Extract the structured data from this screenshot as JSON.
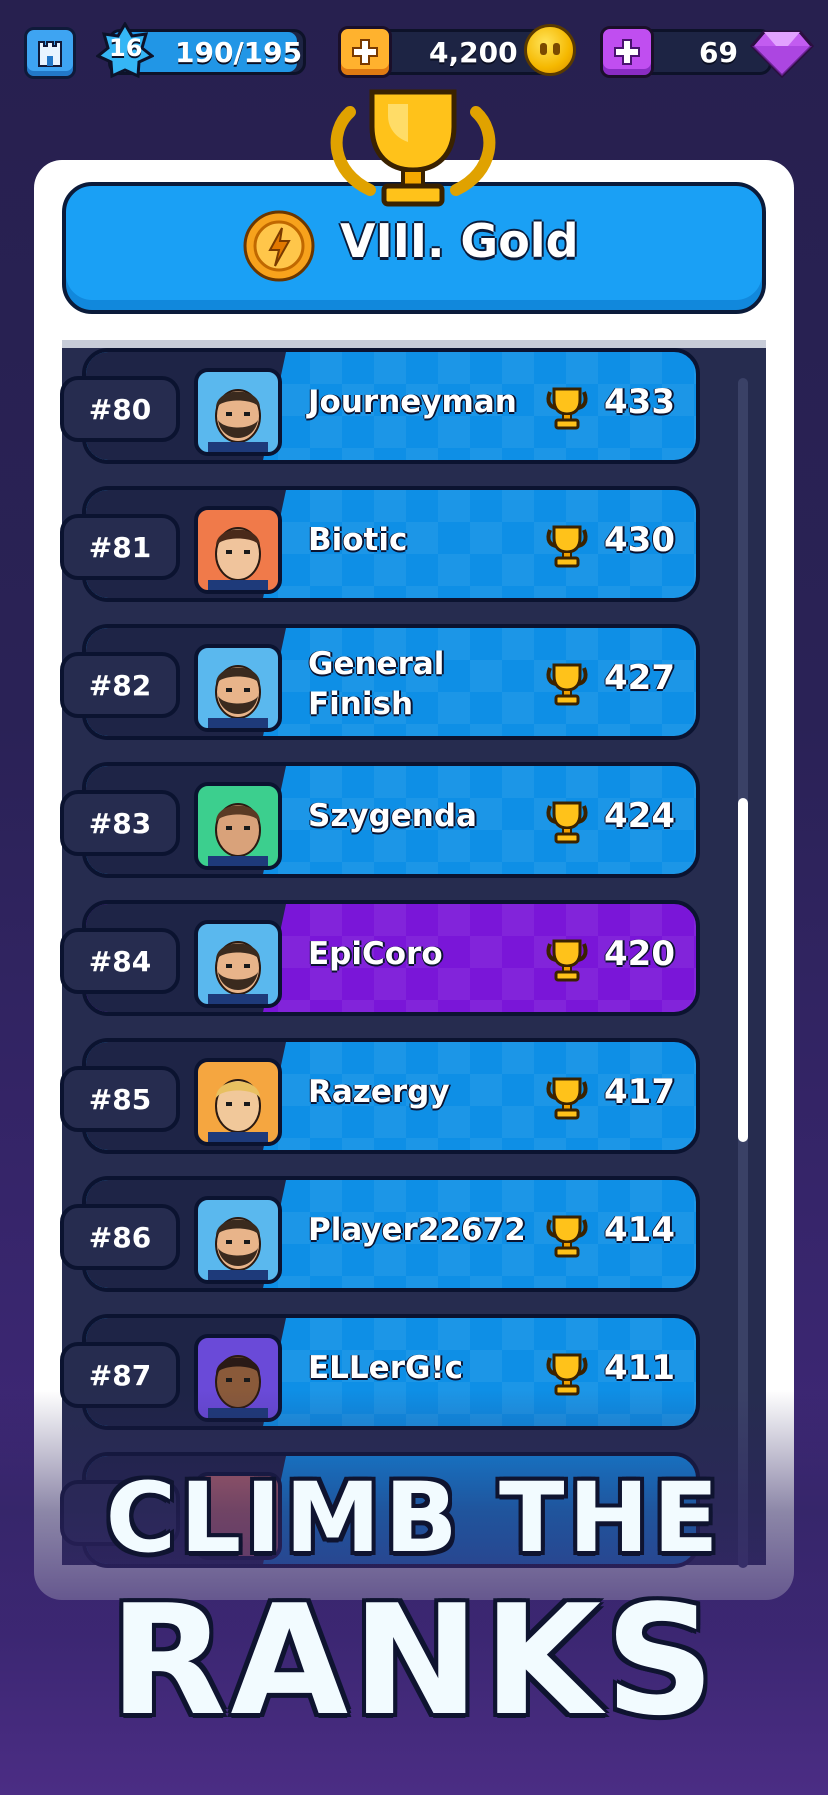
{
  "topbar": {
    "level": "16",
    "xp": "190/195",
    "xp_fraction": 0.974,
    "coins": "4,200",
    "gems": "69",
    "icons": [
      "castle-icon",
      "level-star-icon",
      "add-coins-icon",
      "coin-icon",
      "add-gems-icon",
      "gem-icon"
    ]
  },
  "league": {
    "tier_name": "VIII. Gold",
    "tier_icon": "lightning-badge-icon",
    "trophy_icon": "trophy-icon"
  },
  "leaderboard": {
    "rows": [
      {
        "rank": "#80",
        "name": "Journeyman",
        "score": "433",
        "highlight": false,
        "avatar": "bearded-man"
      },
      {
        "rank": "#81",
        "name": "Biotic",
        "score": "430",
        "highlight": false,
        "avatar": "woman-braid"
      },
      {
        "rank": "#82",
        "name": "General Finish",
        "score": "427",
        "highlight": false,
        "avatar": "bearded-man"
      },
      {
        "rank": "#83",
        "name": "Szygenda",
        "score": "424",
        "highlight": false,
        "avatar": "young-man"
      },
      {
        "rank": "#84",
        "name": "EpiCoro",
        "score": "420",
        "highlight": true,
        "avatar": "bearded-man"
      },
      {
        "rank": "#85",
        "name": "Razergy",
        "score": "417",
        "highlight": false,
        "avatar": "blonde-elf"
      },
      {
        "rank": "#86",
        "name": "Player22672",
        "score": "414",
        "highlight": false,
        "avatar": "bearded-man"
      },
      {
        "rank": "#87",
        "name": "ELLerG!c",
        "score": "411",
        "highlight": false,
        "avatar": "dark-warrior"
      }
    ]
  },
  "tagline": {
    "line1": "CLIMB THE",
    "line2": "RANKS"
  },
  "colors": {
    "row_blue": "#0e8fe6",
    "row_highlight": "#7a16d8",
    "banner": "#1aa0f5",
    "background": "#27204f"
  }
}
